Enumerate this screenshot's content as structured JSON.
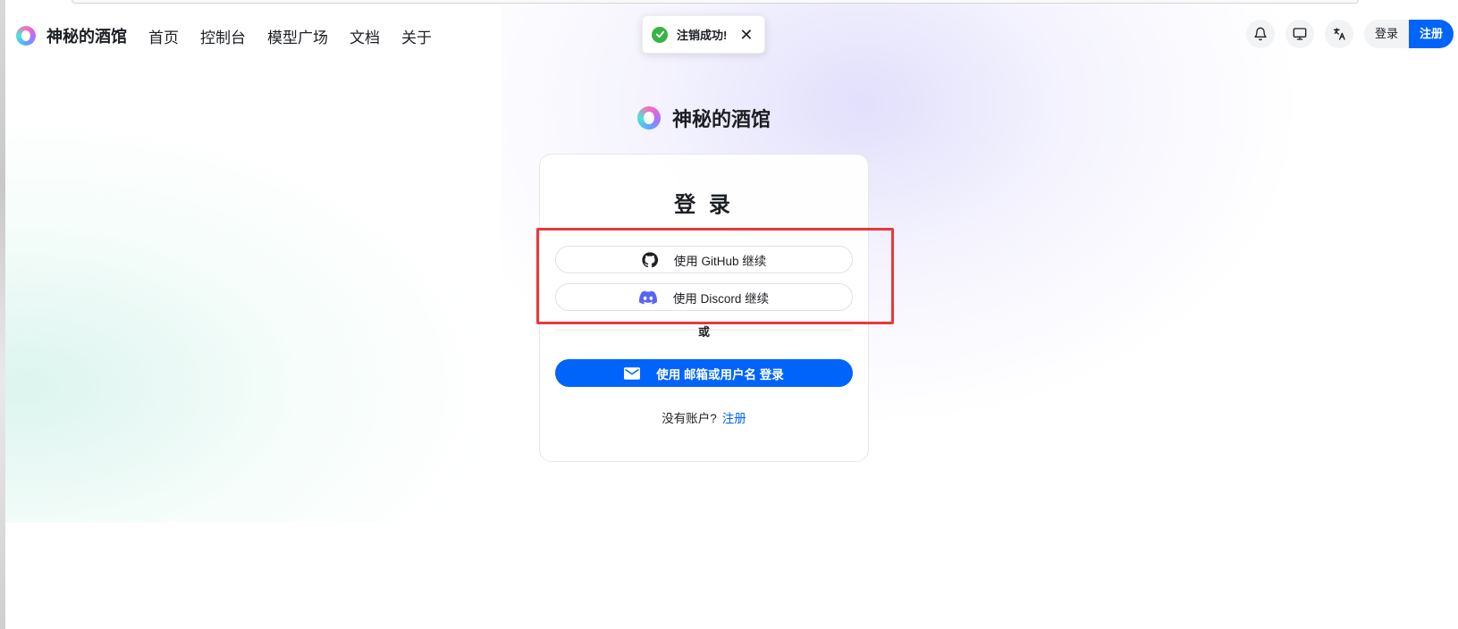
{
  "brand": {
    "name": "神秘的酒馆"
  },
  "nav": {
    "items": [
      "首页",
      "控制台",
      "模型广场",
      "文档",
      "关于"
    ]
  },
  "header": {
    "login_label": "登录",
    "register_label": "注册"
  },
  "toast": {
    "message": "注销成功!",
    "close": "✕"
  },
  "login": {
    "title": "登 录",
    "github_label": "使用 GitHub 继续",
    "discord_label": "使用 Discord 继续",
    "divider": "或",
    "email_label": "使用 邮箱或用户名 登录",
    "no_account": "没有账户?",
    "signup_link": "注册"
  },
  "colors": {
    "primary": "#0064fa",
    "success": "#3bb346",
    "highlight": "#e8383d"
  },
  "icons": [
    "logo-icon",
    "bell-icon",
    "monitor-icon",
    "translate-icon",
    "check-circle-icon",
    "close-icon",
    "github-icon",
    "discord-icon",
    "mail-icon"
  ]
}
